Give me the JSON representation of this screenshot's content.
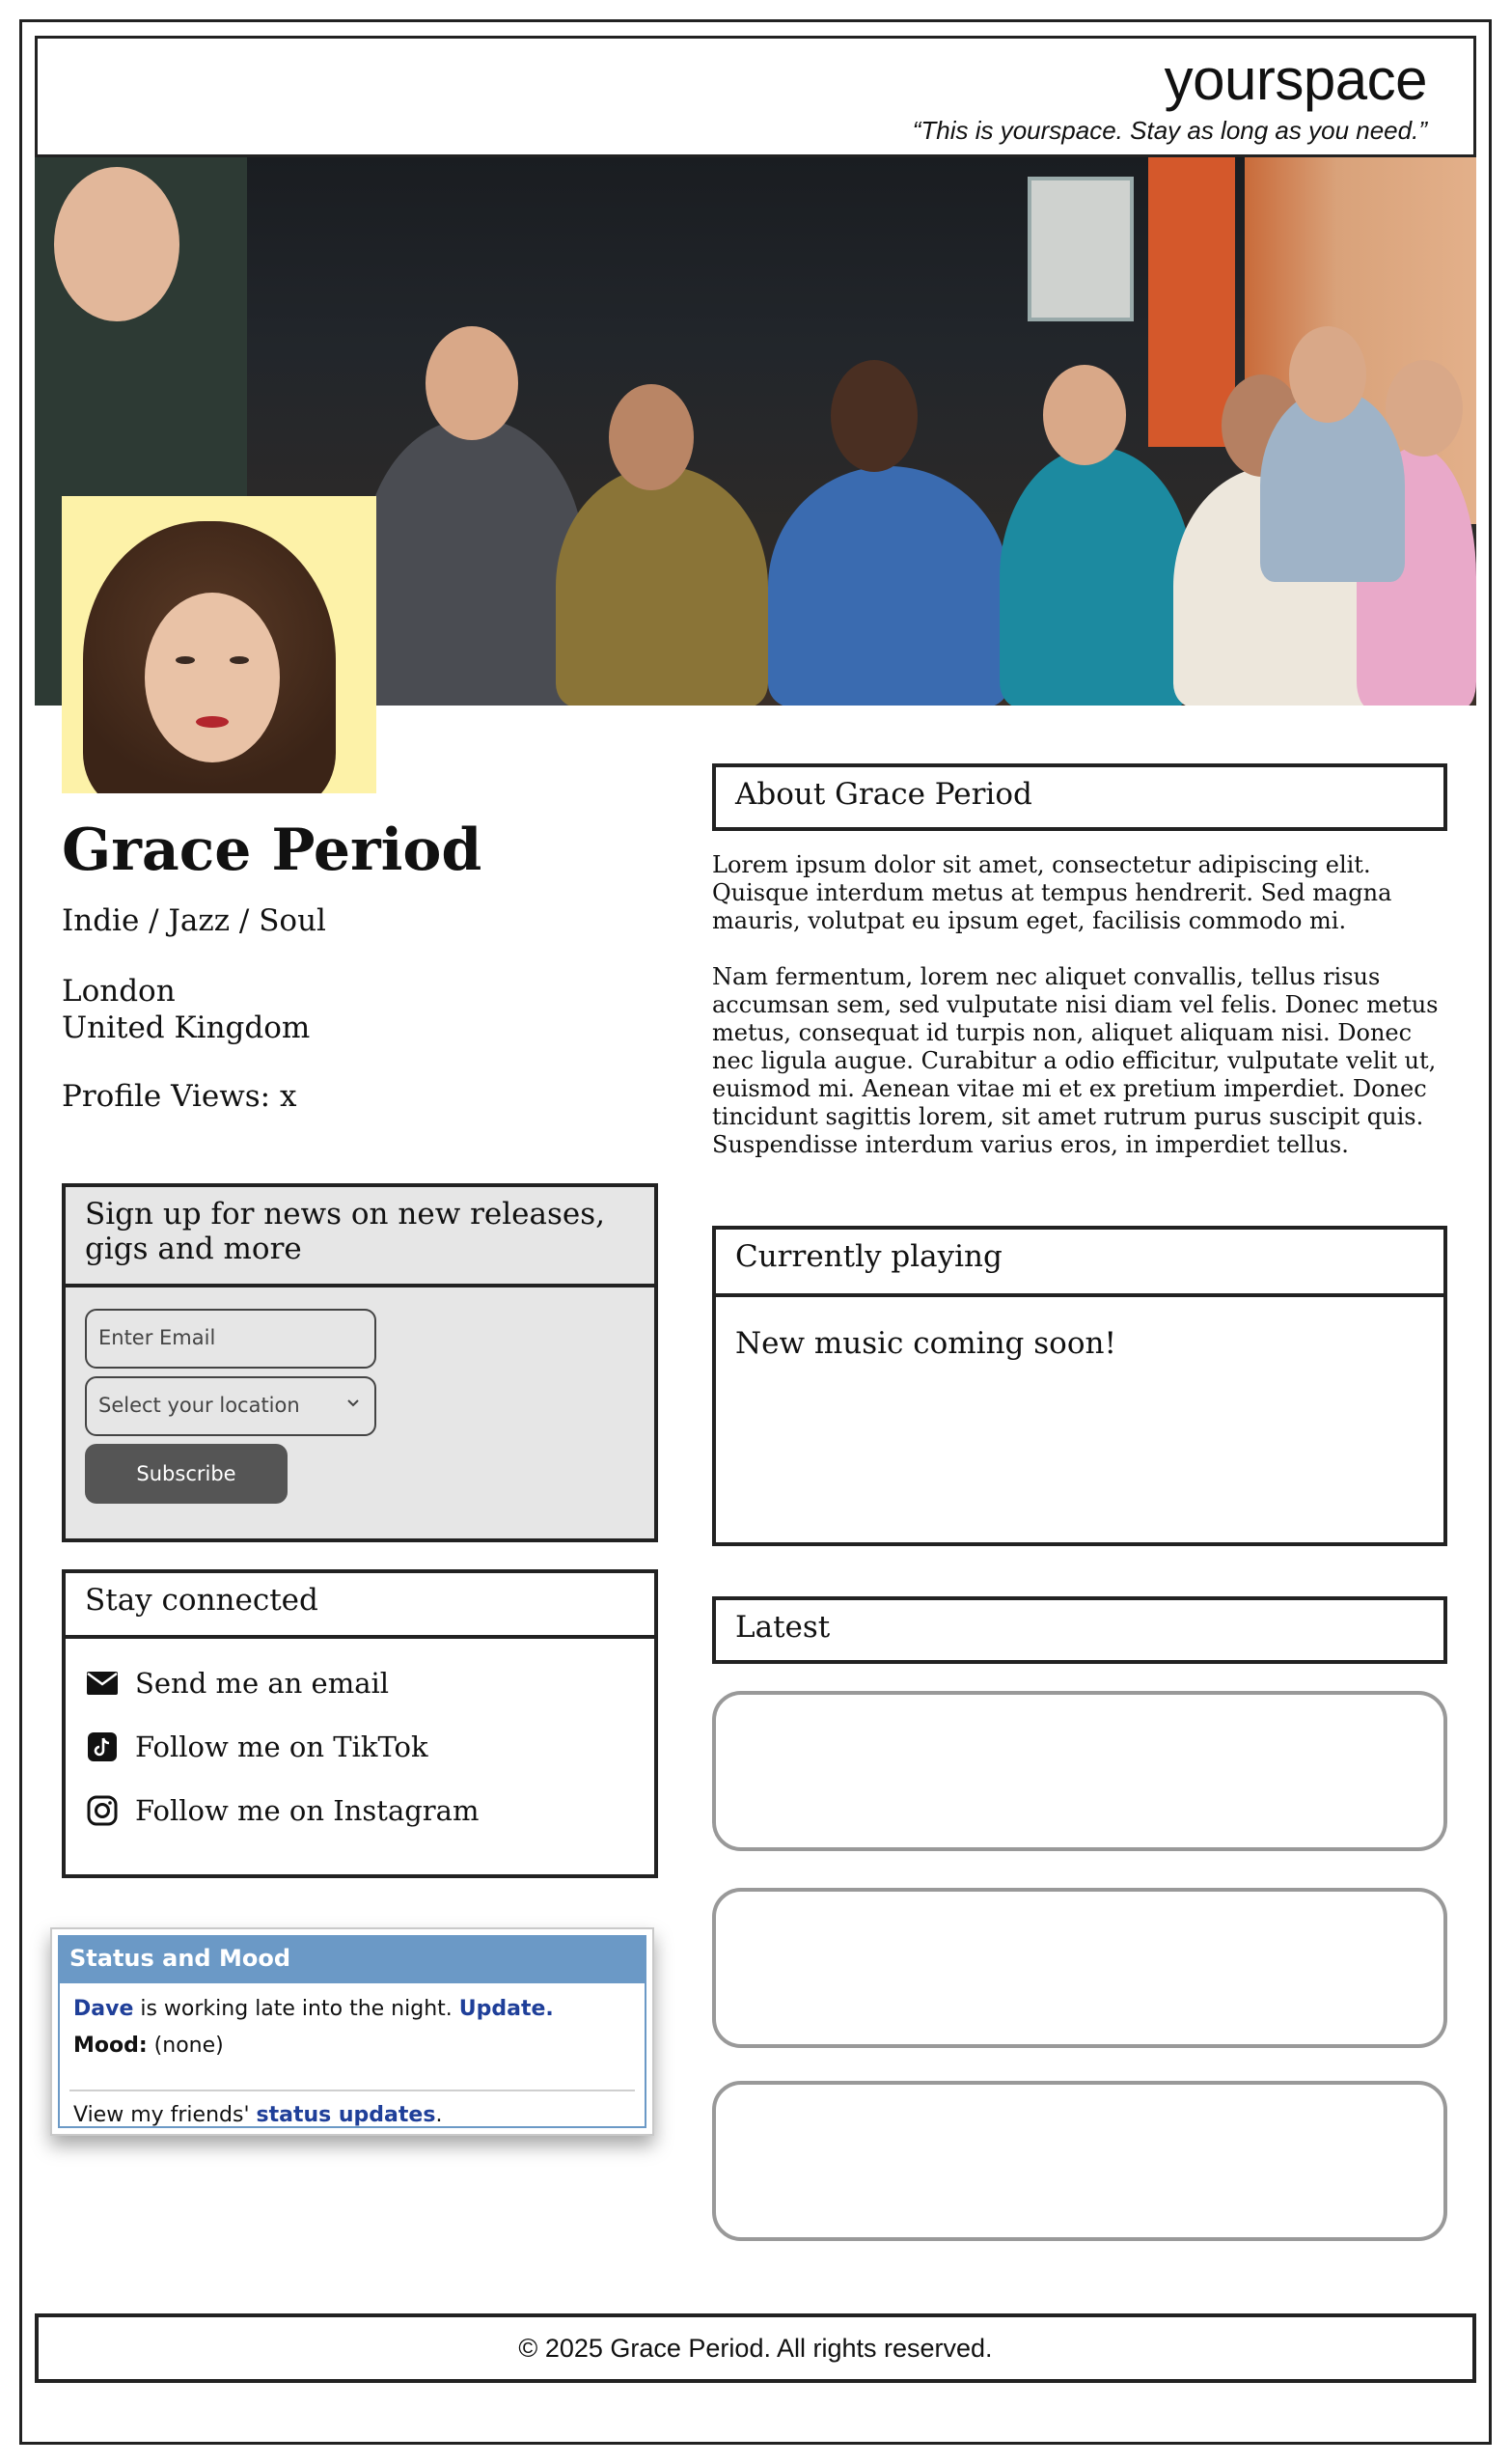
{
  "header": {
    "site_name": "yourspace",
    "tagline": "“This is yourspace. Stay as long as you need.”"
  },
  "profile": {
    "name": "Grace Period",
    "genres": "Indie / Jazz / Soul",
    "city": "London",
    "country": "United Kingdom",
    "views": "Profile Views: x"
  },
  "signup": {
    "title": "Sign up for news on new releases, gigs and more",
    "email_placeholder": "Enter Email",
    "location_placeholder": "Select your location",
    "subscribe_label": "Subscribe"
  },
  "connect": {
    "title": "Stay connected",
    "links": [
      {
        "label": "Send me an email",
        "icon": "envelope-icon"
      },
      {
        "label": "Follow me on TikTok",
        "icon": "tiktok-icon"
      },
      {
        "label": "Follow me on Instagram",
        "icon": "instagram-icon"
      }
    ]
  },
  "status": {
    "title": "Status and Mood",
    "user": "Dave",
    "text": " is working late into the night. ",
    "update_link": "Update.",
    "mood_label": "Mood:",
    "mood_value": " (none)",
    "friends_prefix": "View my friends' ",
    "friends_link": "status updates",
    "friends_suffix": "."
  },
  "about": {
    "title": "About Grace Period",
    "paragraph1": "Lorem ipsum dolor sit amet, consectetur adipiscing elit. Quisque interdum metus at tempus hendrerit. Sed magna mauris, volutpat eu ipsum eget, facilisis commodo mi.",
    "paragraph2": "Nam fermentum, lorem nec aliquet convallis, tellus risus accumsan sem, sed vulputate nisi diam vel felis. Donec metus metus, consequat id turpis non, aliquet aliquam nisi. Donec nec ligula augue. Curabitur a odio efficitur, vulputate velit ut, euismod mi. Aenean vitae mi et ex pretium imperdiet. Donec tincidunt sagittis lorem, sit amet rutrum purus suscipit quis. Suspendisse interdum varius eros, in imperdiet tellus."
  },
  "playing": {
    "title": "Currently playing",
    "text": "New music coming soon!"
  },
  "latest": {
    "title": "Latest"
  },
  "footer": {
    "text": "© 2025 Grace Period. All rights reserved."
  }
}
